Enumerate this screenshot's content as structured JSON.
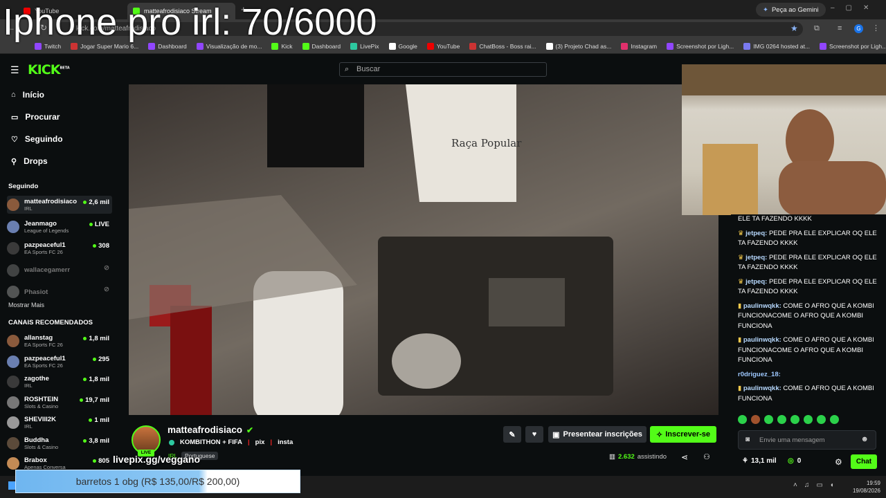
{
  "overlay_title": "Iphone pro irl: 70/6000",
  "browser": {
    "tabs": [
      {
        "label": "YouTube"
      },
      {
        "label": "matteafrodisiaco Stream"
      }
    ],
    "url": "kick.com/matteafrodisiaco",
    "gemini_label": "Peça ao Gemini",
    "bookmarks": [
      "Twitch",
      "Jogar Super Mario 6...",
      "Dashboard",
      "Visualização de mo...",
      "Kick",
      "Dashboard",
      "LivePix",
      "Google",
      "YouTube",
      "ChatBoss - Boss rai...",
      "(3) Projeto Chad as...",
      "Instagram",
      "Screenshot por Ligh...",
      "IMG 0264 hosted at...",
      "Screenshot por Ligh..."
    ]
  },
  "kick": {
    "logo": "KICK",
    "logo_badge": "BETA",
    "search_placeholder": "Buscar",
    "nav": [
      "Início",
      "Procurar",
      "Seguindo",
      "Drops"
    ],
    "following_header": "Seguindo",
    "following": [
      {
        "name": "matteafrodisiaco",
        "cat": "IRL",
        "viewers": "2,6 mil",
        "live": true
      },
      {
        "name": "Jeanmago",
        "cat": "League of Legends",
        "viewers": "LIVE",
        "live": true
      },
      {
        "name": "pazpeaceful1",
        "cat": "EA Sports FC 26",
        "viewers": "308",
        "live": true
      },
      {
        "name": "wallacegamerr",
        "cat": "",
        "viewers": "",
        "live": false
      },
      {
        "name": "Phasiot",
        "cat": "",
        "viewers": "",
        "live": false
      }
    ],
    "show_more": "Mostrar Mais",
    "recommended_header": "CANAIS RECOMENDADOS",
    "recommended": [
      {
        "name": "allanstag",
        "cat": "EA Sports FC 26",
        "viewers": "1,8 mil"
      },
      {
        "name": "pazpeaceful1",
        "cat": "EA Sports FC 26",
        "viewers": "295"
      },
      {
        "name": "zagothe",
        "cat": "IRL",
        "viewers": "1,8 mil"
      },
      {
        "name": "ROSHTEIN",
        "cat": "Slots & Casino",
        "viewers": "19,7 mil"
      },
      {
        "name": "SHEVIII2K",
        "cat": "IRL",
        "viewers": "1 mil"
      },
      {
        "name": "Buddha",
        "cat": "Slots & Casino",
        "viewers": "3,8 mil"
      },
      {
        "name": "Brabox",
        "cat": "Apenas Conversa",
        "viewers": "805"
      }
    ]
  },
  "stream": {
    "channel": "matteafrodisiaco",
    "title_a": "KOMBITHON + FIFA",
    "title_b": "pix",
    "title_c": "insta",
    "category": "IRL",
    "language": "Portuguese",
    "live_badge": "LIVE",
    "gift_label": "Presentear inscrições",
    "subscribe_label": "Inscrever-se",
    "viewers": "2.632",
    "viewers_label": "assistindo"
  },
  "chat": {
    "messages": [
      {
        "user": "",
        "text": "ELE TA FAZENDO KKKK"
      },
      {
        "user": "jetpeq:",
        "text": "PEDE PRA ELE EXPLICAR OQ ELE TA FAZENDO KKKK"
      },
      {
        "user": "jetpeq:",
        "text": "PEDE PRA ELE EXPLICAR OQ ELE TA FAZENDO KKKK"
      },
      {
        "user": "jetpeq:",
        "text": "PEDE PRA ELE EXPLICAR OQ ELE TA FAZENDO KKKK"
      },
      {
        "user": "paulinwqkk:",
        "text": "COME O AFRO QUE A KOMBI FUNCIONACOME O AFRO QUE A KOMBI FUNCIONA"
      },
      {
        "user": "paulinwqkk:",
        "text": "COME O AFRO QUE A KOMBI FUNCIONACOME O AFRO QUE A KOMBI FUNCIONA"
      },
      {
        "user": "r0driguez_18:",
        "text": ""
      },
      {
        "user": "paulinwqkk:",
        "text": "COME O AFRO QUE A KOMBI FUNCIONA"
      }
    ],
    "input_placeholder": "Envie uma mensagem",
    "points": "13,1 mil",
    "points2": "0",
    "chat_button": "Chat"
  },
  "overlays": {
    "livepix": "livepix.gg/veggano",
    "goal": "barretos 1 obg (R$ 135,00/R$ 200,00)",
    "goal_progress": 0.675
  },
  "taskbar": {
    "time": "19:59",
    "date": "19/08/2026"
  }
}
